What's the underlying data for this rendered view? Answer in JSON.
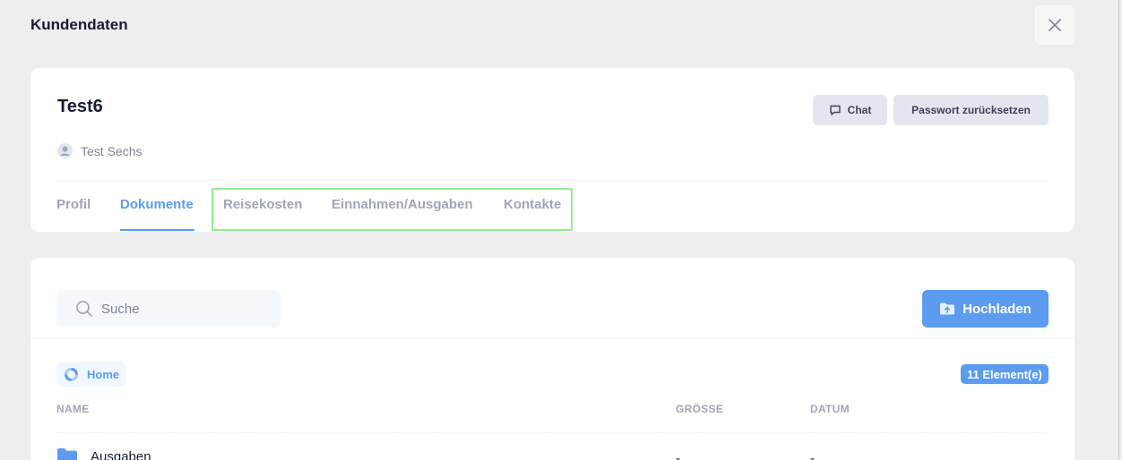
{
  "page": {
    "title": "Kundendaten"
  },
  "customer": {
    "name": "Test6",
    "contact_person": "Test Sechs"
  },
  "actions": {
    "chat_label": "Chat",
    "reset_password_label": "Passwort zurücksetzen"
  },
  "tabs": [
    {
      "label": "Profil",
      "active": false
    },
    {
      "label": "Dokumente",
      "active": true
    },
    {
      "label": "Reisekosten",
      "active": false
    },
    {
      "label": "Einnahmen/Ausgaben",
      "active": false
    },
    {
      "label": "Kontakte",
      "active": false
    }
  ],
  "documents": {
    "search_placeholder": "Suche",
    "upload_label": "Hochladen",
    "breadcrumb": "Home",
    "count_label": "11 Element(e)",
    "columns": {
      "name": "NAME",
      "size": "GRÖSSE",
      "date": "DATUM"
    },
    "rows": [
      {
        "name": "Ausgaben",
        "size": "-",
        "date": "-"
      }
    ]
  },
  "colors": {
    "accent": "#5b9bf0",
    "highlight": "#92ec8c",
    "background": "#eeeeef"
  }
}
